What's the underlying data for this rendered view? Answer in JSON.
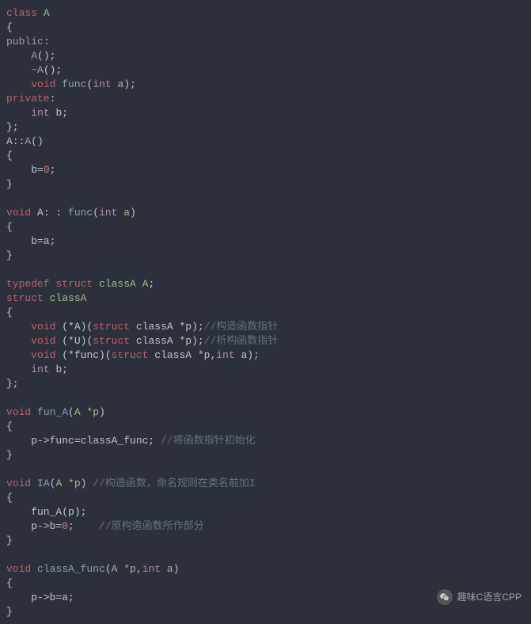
{
  "code": {
    "lines": [
      [
        {
          "t": "class ",
          "c": "kw"
        },
        {
          "t": "A",
          "c": "id"
        }
      ],
      [
        {
          "t": "{",
          "c": "punct"
        }
      ],
      [
        {
          "t": "public",
          "c": "type"
        },
        {
          "t": ":",
          "c": "punct"
        }
      ],
      [
        {
          "t": "    ",
          "c": "punct"
        },
        {
          "t": "A",
          "c": "fn"
        },
        {
          "t": "();",
          "c": "punct"
        }
      ],
      [
        {
          "t": "    ",
          "c": "punct"
        },
        {
          "t": "~A",
          "c": "fn"
        },
        {
          "t": "();",
          "c": "punct"
        }
      ],
      [
        {
          "t": "    ",
          "c": "punct"
        },
        {
          "t": "void ",
          "c": "kw"
        },
        {
          "t": "func",
          "c": "fn"
        },
        {
          "t": "(",
          "c": "punct"
        },
        {
          "t": "int ",
          "c": "type"
        },
        {
          "t": "a",
          "c": "id"
        },
        {
          "t": ");",
          "c": "punct"
        }
      ],
      [
        {
          "t": "private",
          "c": "kw"
        },
        {
          "t": ":",
          "c": "punct"
        }
      ],
      [
        {
          "t": "    ",
          "c": "punct"
        },
        {
          "t": "int ",
          "c": "type"
        },
        {
          "t": "b;",
          "c": "punct"
        }
      ],
      [
        {
          "t": "};",
          "c": "punct"
        }
      ],
      [
        {
          "t": "A::",
          "c": "punct"
        },
        {
          "t": "A",
          "c": "fn"
        },
        {
          "t": "()",
          "c": "punct"
        }
      ],
      [
        {
          "t": "{",
          "c": "punct"
        }
      ],
      [
        {
          "t": "    b=",
          "c": "punct"
        },
        {
          "t": "0",
          "c": "num"
        },
        {
          "t": ";",
          "c": "punct"
        }
      ],
      [
        {
          "t": "}",
          "c": "punct"
        }
      ],
      [
        {
          "t": "",
          "c": "punct"
        }
      ],
      [
        {
          "t": "void ",
          "c": "kw"
        },
        {
          "t": "A: : ",
          "c": "punct"
        },
        {
          "t": "func",
          "c": "fn"
        },
        {
          "t": "(",
          "c": "punct"
        },
        {
          "t": "int ",
          "c": "type"
        },
        {
          "t": "a",
          "c": "id"
        },
        {
          "t": ")",
          "c": "punct"
        }
      ],
      [
        {
          "t": "{",
          "c": "punct"
        }
      ],
      [
        {
          "t": "    b=a;",
          "c": "punct"
        }
      ],
      [
        {
          "t": "}",
          "c": "punct"
        }
      ],
      [
        {
          "t": "",
          "c": "punct"
        }
      ],
      [
        {
          "t": "typedef ",
          "c": "kw"
        },
        {
          "t": "struct ",
          "c": "kw"
        },
        {
          "t": "classA ",
          "c": "id"
        },
        {
          "t": "A",
          "c": "id"
        },
        {
          "t": ";",
          "c": "punct"
        }
      ],
      [
        {
          "t": "struct ",
          "c": "kw"
        },
        {
          "t": "classA",
          "c": "id"
        }
      ],
      [
        {
          "t": "{",
          "c": "punct"
        }
      ],
      [
        {
          "t": "    ",
          "c": "punct"
        },
        {
          "t": "void ",
          "c": "kw"
        },
        {
          "t": "(*A)(",
          "c": "punct"
        },
        {
          "t": "struct ",
          "c": "kw"
        },
        {
          "t": "classA *p);",
          "c": "punct"
        },
        {
          "t": "//构造函数指针",
          "c": "comment"
        }
      ],
      [
        {
          "t": "    ",
          "c": "punct"
        },
        {
          "t": "void ",
          "c": "kw"
        },
        {
          "t": "(*U)(",
          "c": "punct"
        },
        {
          "t": "struct ",
          "c": "kw"
        },
        {
          "t": "classA *p);",
          "c": "punct"
        },
        {
          "t": "//析构函数指针",
          "c": "comment"
        }
      ],
      [
        {
          "t": "    ",
          "c": "punct"
        },
        {
          "t": "void ",
          "c": "kw"
        },
        {
          "t": "(*func)(",
          "c": "punct"
        },
        {
          "t": "struct ",
          "c": "kw"
        },
        {
          "t": "classA *p,",
          "c": "punct"
        },
        {
          "t": "int ",
          "c": "type"
        },
        {
          "t": "a);",
          "c": "punct"
        }
      ],
      [
        {
          "t": "    ",
          "c": "punct"
        },
        {
          "t": "int ",
          "c": "type"
        },
        {
          "t": "b;",
          "c": "punct"
        }
      ],
      [
        {
          "t": "};",
          "c": "punct"
        }
      ],
      [
        {
          "t": "",
          "c": "punct"
        }
      ],
      [
        {
          "t": "void ",
          "c": "kw"
        },
        {
          "t": "fun_A",
          "c": "fn"
        },
        {
          "t": "(",
          "c": "punct"
        },
        {
          "t": "A ",
          "c": "id"
        },
        {
          "t": "*p",
          "c": "id"
        },
        {
          "t": ")",
          "c": "punct"
        }
      ],
      [
        {
          "t": "{",
          "c": "punct"
        }
      ],
      [
        {
          "t": "    p->func=classA_func; ",
          "c": "punct"
        },
        {
          "t": "//将函数指针初始化",
          "c": "comment"
        }
      ],
      [
        {
          "t": "}",
          "c": "punct"
        }
      ],
      [
        {
          "t": "",
          "c": "punct"
        }
      ],
      [
        {
          "t": "void ",
          "c": "kw"
        },
        {
          "t": "IA",
          "c": "fn"
        },
        {
          "t": "(",
          "c": "punct"
        },
        {
          "t": "A ",
          "c": "id"
        },
        {
          "t": "*p",
          "c": "id"
        },
        {
          "t": ") ",
          "c": "punct"
        },
        {
          "t": "//构造函数，命名规则在类名前加I",
          "c": "comment"
        }
      ],
      [
        {
          "t": "{",
          "c": "punct"
        }
      ],
      [
        {
          "t": "    fun_A(p);",
          "c": "punct"
        }
      ],
      [
        {
          "t": "    p->b=",
          "c": "punct"
        },
        {
          "t": "0",
          "c": "num"
        },
        {
          "t": ";    ",
          "c": "punct"
        },
        {
          "t": "//原构造函数所作部分",
          "c": "comment"
        }
      ],
      [
        {
          "t": "}",
          "c": "punct"
        }
      ],
      [
        {
          "t": "",
          "c": "punct"
        }
      ],
      [
        {
          "t": "void ",
          "c": "kw"
        },
        {
          "t": "classA_func",
          "c": "fn"
        },
        {
          "t": "(",
          "c": "punct"
        },
        {
          "t": "A ",
          "c": "id"
        },
        {
          "t": "*p",
          "c": "id"
        },
        {
          "t": ",",
          "c": "punct"
        },
        {
          "t": "int ",
          "c": "type"
        },
        {
          "t": "a",
          "c": "id"
        },
        {
          "t": ")",
          "c": "punct"
        }
      ],
      [
        {
          "t": "{",
          "c": "punct"
        }
      ],
      [
        {
          "t": "    p->b=a;",
          "c": "punct"
        }
      ],
      [
        {
          "t": "}",
          "c": "punct"
        }
      ]
    ]
  },
  "watermark": {
    "text": "趣味C语言CPP"
  }
}
